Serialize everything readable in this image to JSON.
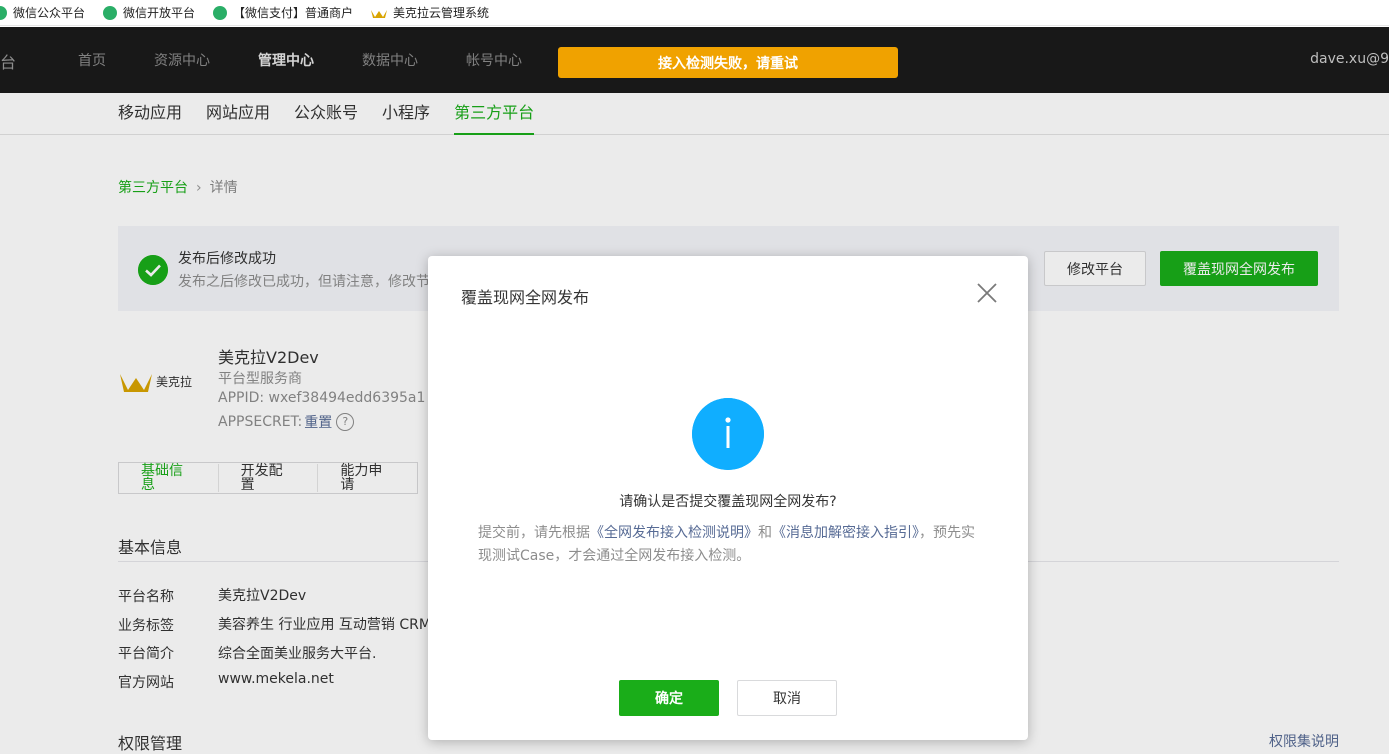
{
  "bookmarks": [
    {
      "label": "微信公众平台"
    },
    {
      "label": "微信开放平台"
    },
    {
      "label": "【微信支付】普通商户"
    },
    {
      "label": "美克拉云管理系统"
    }
  ],
  "topnav": {
    "brand_tail": "台",
    "items": [
      "首页",
      "资源中心",
      "管理中心",
      "数据中心",
      "帐号中心"
    ],
    "user": "dave.xu@9"
  },
  "toast": "接入检测失败，请重试",
  "subnav": [
    "移动应用",
    "网站应用",
    "公众账号",
    "小程序",
    "第三方平台"
  ],
  "breadcrumb": {
    "parent": "第三方平台",
    "separator": "›",
    "current": "详情"
  },
  "notice": {
    "title": "发布后修改成功",
    "desc": "发布之后修改已成功，但请注意，修改节"
  },
  "buttons": {
    "edit": "修改平台",
    "publish": "覆盖现网全网发布"
  },
  "platform": {
    "logo_text": "美克拉",
    "name": "美克拉V2Dev",
    "type": "平台型服务商",
    "appid": "APPID: wxef38494edd6395a1",
    "appsecret_label": "APPSECRET:",
    "appsecret_reset": "重置",
    "help": "?"
  },
  "tabs": [
    "基础信息",
    "开发配置",
    "能力申请"
  ],
  "basic_info": {
    "title": "基本信息",
    "rows": [
      {
        "label": "平台名称",
        "value": "美克拉V2Dev"
      },
      {
        "label": "业务标签",
        "value": "美容养生 行业应用 互动营销 CRM"
      },
      {
        "label": "平台简介",
        "value": "综合全面美业服务大平台."
      },
      {
        "label": "官方网站",
        "value": "www.mekela.net"
      }
    ]
  },
  "permissions": {
    "title": "权限管理",
    "link": "权限集说明"
  },
  "dialog": {
    "title": "覆盖现网全网发布",
    "question": "请确认是否提交覆盖现网全网发布?",
    "desc_1": "提交前，请先根据",
    "link_1": "《全网发布接入检测说明》",
    "desc_2": "和",
    "link_2": "《消息加解密接入指引》",
    "desc_3": "，预先实现测试Case，才会通过全网发布接入检测。",
    "ok": "确定",
    "cancel": "取消"
  },
  "colors": {
    "accent": "#1aad19",
    "warning": "#f0a200",
    "info": "#10aeff",
    "link": "#576b95"
  }
}
